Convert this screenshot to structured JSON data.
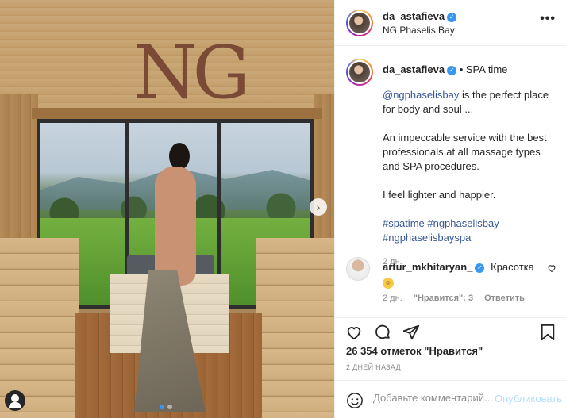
{
  "header": {
    "username": "da_astafieva",
    "location": "NG Phaselis Bay",
    "more_label": "•••"
  },
  "photo": {
    "logo_text": "NG",
    "next_icon": "chevron-right-icon",
    "next_glyph": "›",
    "slide_index": 1,
    "slide_count": 2
  },
  "caption": {
    "username": "da_astafieva",
    "separator": "•",
    "location_note": "SPA time",
    "mention": "@ngphaselisbay",
    "line1_rest": "is the perfect place for body and soul ...",
    "paragraph2": "An impeccable service with the best professionals at all massage types and SPA procedures.",
    "paragraph3": "I feel lighter and happier.",
    "hashtags_line1": "#spatime #ngphaselisbay",
    "hashtags_line2": "#ngphaselisbayspa",
    "time": "2 дн."
  },
  "comment": {
    "username": "artur_mkhitaryan_",
    "text": "Красотка",
    "emoji_glyph": "☺",
    "time": "2 дн.",
    "likes": "\"Нравится\": 3",
    "reply": "Ответить"
  },
  "actions": {
    "likes_text": "26 354 отметок \"Нравится\"",
    "posted_ago": "2 ДНЕЙ НАЗАД"
  },
  "comment_bar": {
    "placeholder": "Добавьте комментарий...",
    "post_label": "Опубликовать"
  },
  "colors": {
    "link": "#385898",
    "verified": "#3897f0",
    "muted": "#8e8e8e",
    "post_disabled": "#b2dffc"
  }
}
